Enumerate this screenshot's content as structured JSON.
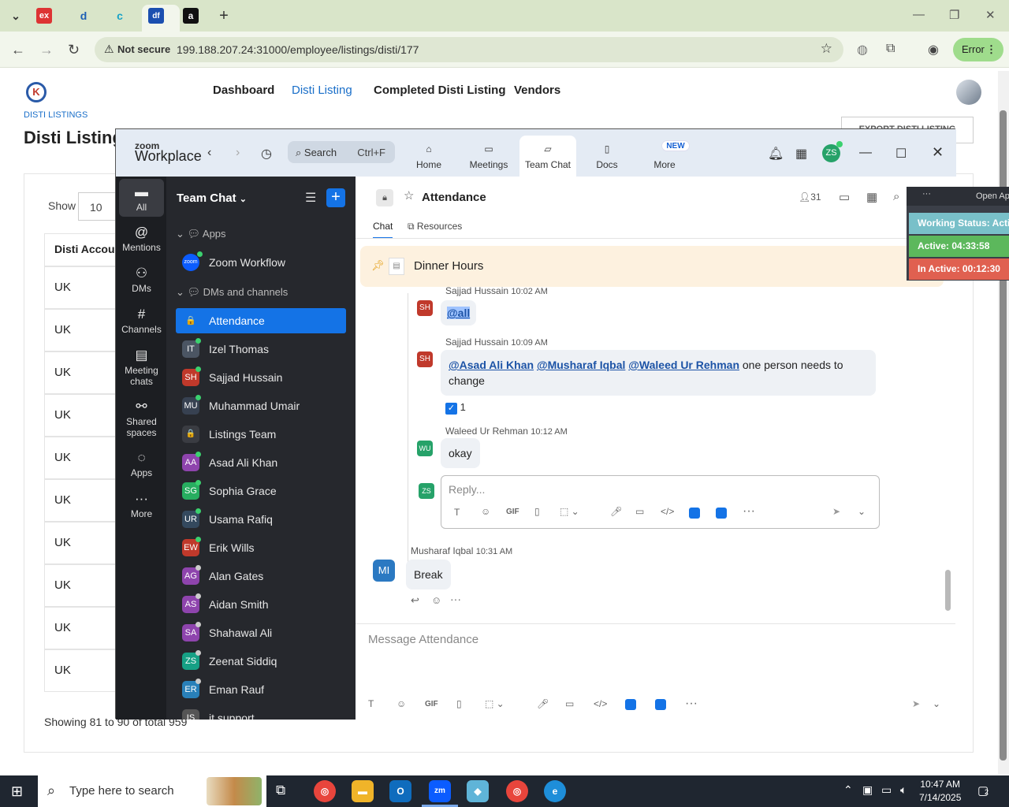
{
  "browser": {
    "tabs": [
      {
        "icon": "ex",
        "color": "#d33"
      },
      {
        "icon": "d",
        "color": "#1d5fb5"
      },
      {
        "icon": "c",
        "color": "#17a2c8"
      },
      {
        "icon": "df",
        "color": "#1b4fb0"
      },
      {
        "icon": "a",
        "color": "#111"
      }
    ],
    "url_security": "Not secure",
    "url": "199.188.207.24:31000/employee/listings/disti/177",
    "error_label": "Error"
  },
  "site": {
    "logo": "K",
    "nav": [
      "Dashboard",
      "Disti Listing",
      "Completed Disti Listing",
      "Vendors"
    ],
    "breadcrumb": "DISTI LISTINGS",
    "page_title": "Disti Listings",
    "export_label": "EXPORT DISTI LISTING",
    "show_label": "Show",
    "show_value": "10",
    "column_header": "Disti Account",
    "rows": [
      "UK",
      "UK",
      "UK",
      "UK",
      "UK",
      "UK",
      "UK",
      "UK",
      "UK",
      "UK"
    ],
    "showing": "Showing 81 to 90 of total 959"
  },
  "zoom": {
    "logo_top": "zoom",
    "logo_bottom": "Workplace",
    "search_placeholder": "Search",
    "search_shortcut": "Ctrl+F",
    "tabs": [
      "Home",
      "Meetings",
      "Team Chat",
      "Docs",
      "More"
    ],
    "new_badge": "NEW",
    "user_initials": "ZS",
    "rail": [
      {
        "label": "All",
        "icon": "▬"
      },
      {
        "label": "Mentions",
        "icon": "@"
      },
      {
        "label": "DMs",
        "icon": "⚇"
      },
      {
        "label": "Channels",
        "icon": "#"
      },
      {
        "label": "Meeting chats",
        "icon": "▤"
      },
      {
        "label": "Shared spaces",
        "icon": "⚯"
      },
      {
        "label": "Apps",
        "icon": "◌"
      },
      {
        "label": "More",
        "icon": "···"
      }
    ],
    "list_title": "Team Chat",
    "sections": {
      "apps": "Apps",
      "dms": "DMs and channels"
    },
    "apps": [
      {
        "name": "Zoom Workflow",
        "initials": "zoom"
      }
    ],
    "channels": [
      {
        "name": "Attendance",
        "initials": "🔒"
      },
      {
        "name": "Izel Thomas",
        "initials": "IT"
      },
      {
        "name": "Sajjad Hussain",
        "initials": "SH"
      },
      {
        "name": "Muhammad Umair",
        "initials": "MU"
      },
      {
        "name": "Listings Team",
        "initials": "🔒"
      },
      {
        "name": "Asad Ali Khan",
        "initials": "AA"
      },
      {
        "name": "Sophia Grace",
        "initials": "SG"
      },
      {
        "name": "Usama Rafiq",
        "initials": "UR"
      },
      {
        "name": "Erik Wills",
        "initials": "EW"
      },
      {
        "name": "Alan Gates",
        "initials": "AG"
      },
      {
        "name": "Aidan Smith",
        "initials": "AS"
      },
      {
        "name": "Shahawal Ali",
        "initials": "SA"
      },
      {
        "name": "Zeenat Siddiq",
        "initials": "ZS"
      },
      {
        "name": "Eman Rauf",
        "initials": "ER"
      },
      {
        "name": "it support",
        "initials": "IS"
      }
    ],
    "chat": {
      "title": "Attendance",
      "members": "31",
      "subtabs": [
        "Chat",
        "Resources"
      ],
      "pinned": "Dinner Hours",
      "messages": [
        {
          "initials": "SH",
          "author": "Sajjad Hussain",
          "time": "10:02 AM",
          "mention": "@all"
        },
        {
          "initials": "SH",
          "author": "Sajjad Hussain",
          "time": "10:09 AM",
          "mentions": [
            "@Asad Ali Khan",
            "@Musharaf Iqbal",
            "@Waleed Ur Rehman"
          ],
          "text_line1": "one person needs to",
          "text_line2": "change",
          "reaction_count": "1"
        },
        {
          "initials": "WU",
          "author": "Waleed Ur Rehman",
          "time": "10:12 AM",
          "text": "okay"
        }
      ],
      "reply_initials": "ZS",
      "reply_placeholder": "Reply...",
      "last_message": {
        "initials": "MI",
        "author": "Musharaf Iqbal",
        "time": "10:31 AM",
        "text": "Break"
      },
      "compose_placeholder": "Message Attendance"
    }
  },
  "tracker": {
    "open_label": "Open Ap",
    "status": "Working Status: Active",
    "active": "Active: 04:33:58",
    "inactive": "In Active: 00:12:30"
  },
  "taskbar": {
    "search_placeholder": "Type here to search",
    "time": "10:47 AM",
    "date": "7/14/2025",
    "notifications": "2"
  }
}
